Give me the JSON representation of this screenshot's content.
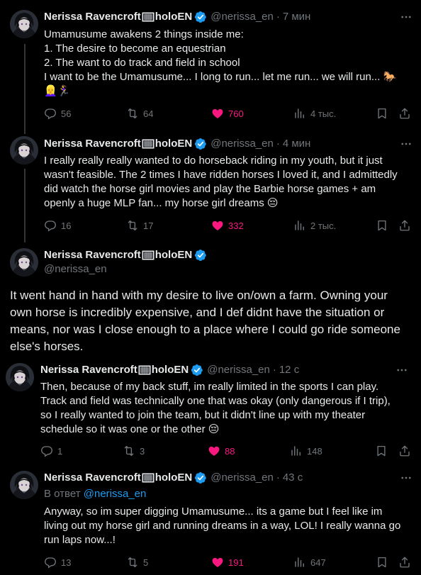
{
  "author": {
    "name": "Nerissa Ravencroft",
    "name_suffix": "holoEN",
    "handle": "@nerissa_en"
  },
  "tweets": [
    {
      "time": "7 мин",
      "lines": [
        "Umamusume awakens 2 things inside me:",
        "1. The desire to become an equestrian",
        "2. The want to do track and field in school",
        "I want to be the Umamusume... I long to run... let me run... we will run... 🐎",
        "👱‍♀️🏃‍♀️"
      ],
      "replies": "56",
      "retweets": "64",
      "likes": "760",
      "views": "4 тыс."
    },
    {
      "time": "4 мин",
      "lines": [
        "I really really really wanted to do horseback riding in my youth, but it just",
        "wasn't feasible. The 2 times I have ridden horses I loved it, and I admittedly",
        "did watch the horse girl movies and play the Barbie horse games + am",
        "openly a huge MLP fan... my horse girl dreams 😔"
      ],
      "replies": "16",
      "retweets": "17",
      "likes": "332",
      "views": "2 тыс."
    },
    {
      "lines": [
        "It went hand in hand with my desire to live on/own a farm. Owning your",
        "own horse is incredibly expensive, and I def didnt have the situation or",
        "means, nor was I close enough to a place where I could go ride someone",
        "else's horses."
      ]
    },
    {
      "time": "12 с",
      "lines": [
        "Then, because of my back stuff, im really limited in the sports I can play.",
        "Track and field was technically one that was okay (only dangerous if I trip),",
        "so I really wanted to join the team, but it didn't line up with my theater",
        "schedule so it was one or the other 😔"
      ],
      "replies": "1",
      "retweets": "3",
      "likes": "88",
      "views": "148"
    },
    {
      "time": "43 с",
      "reply_prefix": "В ответ",
      "reply_mention": "@nerissa_en",
      "lines": [
        "Anyway, so im super digging Umamusume... its a game but I feel like im",
        "living out my horse girl and running dreams in a way, LOL! I really wanna go",
        "run laps now...!"
      ],
      "replies": "13",
      "retweets": "5",
      "likes": "191",
      "views": "647"
    }
  ],
  "colors": {
    "background": "#000000",
    "text": "#e7e9ea",
    "muted": "#71767b",
    "verified": "#1d9bf0",
    "like": "#f91880",
    "thread_line": "#333639"
  },
  "icons": [
    "reply-icon",
    "retweet-icon",
    "heart-icon",
    "views-icon",
    "bookmark-icon",
    "share-icon",
    "more-icon",
    "verified-icon",
    "avatar"
  ]
}
